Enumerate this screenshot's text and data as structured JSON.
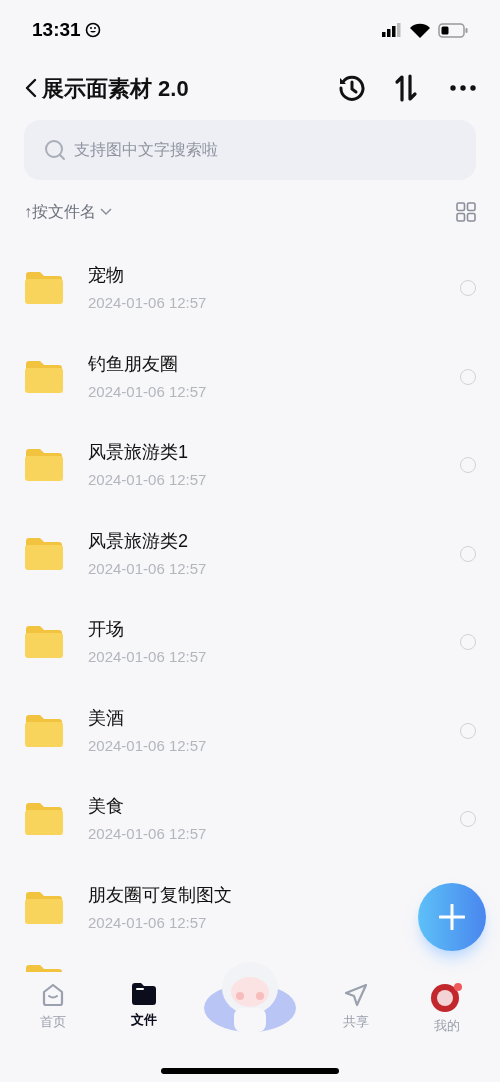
{
  "status_bar": {
    "time": "13:31"
  },
  "header": {
    "title": "展示面素材 2.0"
  },
  "search": {
    "placeholder": "支持图中文字搜索啦"
  },
  "sort": {
    "arrow": "↑",
    "label": "按文件名"
  },
  "files": [
    {
      "name": "宠物",
      "date": "2024-01-06 12:57",
      "selected": false
    },
    {
      "name": "钓鱼朋友圈",
      "date": "2024-01-06 12:57",
      "selected": false
    },
    {
      "name": "风景旅游类1",
      "date": "2024-01-06 12:57",
      "selected": false
    },
    {
      "name": "风景旅游类2",
      "date": "2024-01-06 12:57",
      "selected": false
    },
    {
      "name": "开场",
      "date": "2024-01-06 12:57",
      "selected": false
    },
    {
      "name": "美酒",
      "date": "2024-01-06 12:57",
      "selected": false
    },
    {
      "name": "美食",
      "date": "2024-01-06 12:57",
      "selected": false
    },
    {
      "name": "朋友圈可复制图文",
      "date": "2024-01-06 12:57"
    }
  ],
  "tabs": [
    {
      "kind": "home",
      "label": "首页",
      "selected": false
    },
    {
      "kind": "files",
      "label": "文件",
      "selected": true
    },
    {
      "kind": "mascot"
    },
    {
      "kind": "share",
      "label": "共享",
      "selected": false
    },
    {
      "kind": "me",
      "label": "我的",
      "selected": false
    }
  ]
}
